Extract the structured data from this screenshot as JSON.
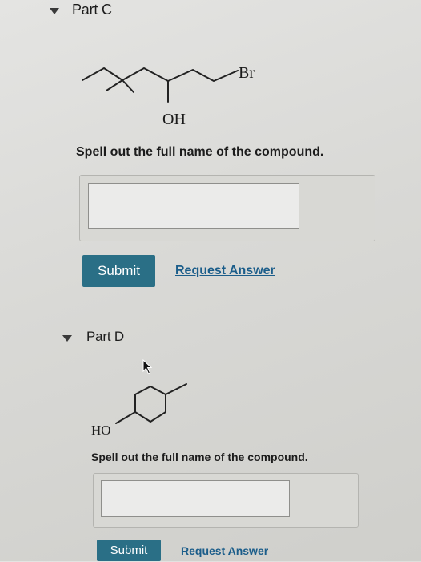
{
  "partC": {
    "title": "Part C",
    "structure_labels": {
      "br": "Br",
      "oh": "OH"
    },
    "prompt": "Spell out the full name of the compound.",
    "input_value": "",
    "submit_label": "Submit",
    "request_answer_label": "Request Answer"
  },
  "partD": {
    "title": "Part D",
    "structure_labels": {
      "ho": "HO"
    },
    "prompt": "Spell out the full name of the compound.",
    "input_value": "",
    "submit_label": "Submit",
    "request_answer_label": "Request Answer"
  },
  "colors": {
    "submit_bg": "#2a6f86",
    "link": "#1b5d8a"
  },
  "icons": [
    "caret-down-icon",
    "mouse-cursor-icon"
  ]
}
